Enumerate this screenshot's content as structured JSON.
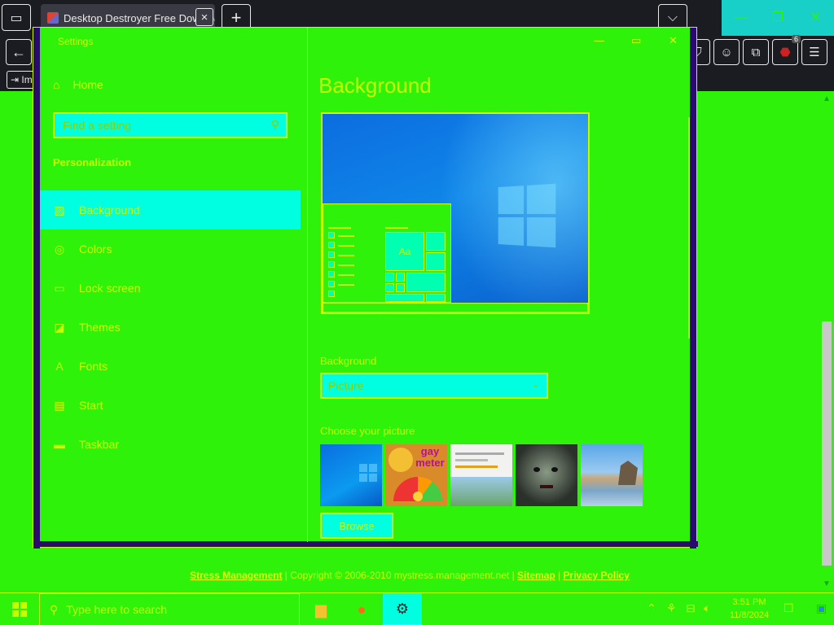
{
  "browser": {
    "tab_title": "Desktop Destroyer Free Download",
    "bookmark_label": "Im",
    "extension_badge": "6"
  },
  "settings": {
    "window_title": "Settings",
    "home_label": "Home",
    "search_placeholder": "Find a setting",
    "section_label": "Personalization",
    "nav_items": [
      {
        "label": "Background",
        "icon": "picture-icon"
      },
      {
        "label": "Colors",
        "icon": "palette-icon"
      },
      {
        "label": "Lock screen",
        "icon": "lock-screen-icon"
      },
      {
        "label": "Themes",
        "icon": "themes-icon"
      },
      {
        "label": "Fonts",
        "icon": "fonts-icon"
      },
      {
        "label": "Start",
        "icon": "start-icon"
      },
      {
        "label": "Taskbar",
        "icon": "taskbar-icon"
      }
    ],
    "page_heading": "Background",
    "preview_tile_text": "Aa",
    "background_label": "Background",
    "background_value": "Picture",
    "choose_picture_label": "Choose your picture",
    "browse_label": "Browse",
    "thumbnails": [
      {
        "name": "windows-wallpaper"
      },
      {
        "name": "meter-image",
        "caption": "gay meter"
      },
      {
        "name": "webpage-screenshot"
      },
      {
        "name": "scary-face"
      },
      {
        "name": "beach-landscape"
      }
    ]
  },
  "footer": {
    "link1": "Stress Management",
    "copyright": " | Copyright © 2006-2010 mystress.management.net | ",
    "link2": "Sitemap",
    "sep": " | ",
    "link3": "Privacy Policy"
  },
  "taskbar": {
    "search_placeholder": "Type here to search",
    "time": "3:51 PM",
    "date": "11/8/2024"
  },
  "colors": {
    "page_bg": "#2ff20a",
    "accent_cyan": "#00ffe0",
    "text_yellow": "#c8ff00",
    "frame_purple": "#2a0a6e"
  }
}
